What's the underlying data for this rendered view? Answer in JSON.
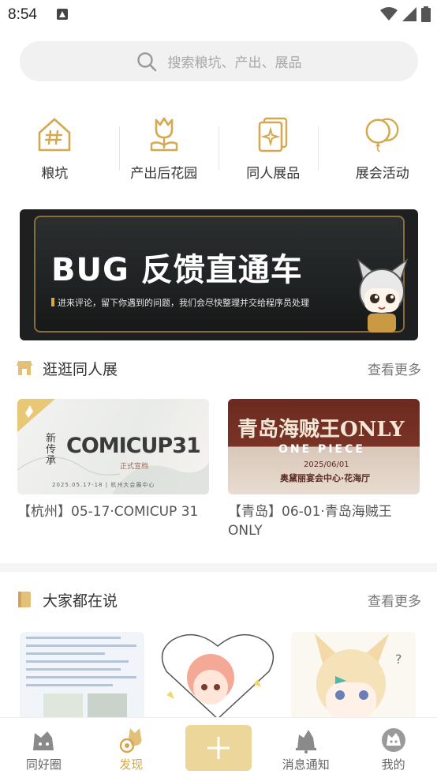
{
  "status": {
    "time": "8:54"
  },
  "search": {
    "placeholder": "搜索粮坑、产出、展品"
  },
  "categories": [
    {
      "label": "粮坑",
      "icon": "house-hash-icon"
    },
    {
      "label": "产出后花园",
      "icon": "tulip-icon"
    },
    {
      "label": "同人展品",
      "icon": "card-icon"
    },
    {
      "label": "展会活动",
      "icon": "balloons-icon"
    }
  ],
  "banner": {
    "title": "BUG 反馈直通车",
    "subtitle": "进来评论，留下你遇到的问题，我们会尽快整理并交给程序员处理"
  },
  "expo_section": {
    "title": "逛逛同人展",
    "more": "查看更多",
    "cards": [
      {
        "caption": "【杭州】05-17·COMICUP 31",
        "image_title": "COMICUP31",
        "image_side": "新传承",
        "image_sub": "正式宣档",
        "image_date": "2025.05.17-18 | 杭州大会展中心"
      },
      {
        "caption": "【青岛】06-01·青岛海贼王ONLY",
        "image_title": "青岛海贼王ONLY",
        "image_sub": "ONE PIECE",
        "image_date": "2025/06/01",
        "image_venue": "奥黛丽宴会中心·花海厅"
      }
    ]
  },
  "discuss_section": {
    "title": "大家都在说",
    "more": "查看更多"
  },
  "nav": {
    "items": [
      {
        "label": "同好圈"
      },
      {
        "label": "发现"
      },
      {
        "label": "消息通知"
      },
      {
        "label": "我的"
      }
    ]
  },
  "colors": {
    "accent": "#d4a84e",
    "add_button": "#ecd69a"
  }
}
